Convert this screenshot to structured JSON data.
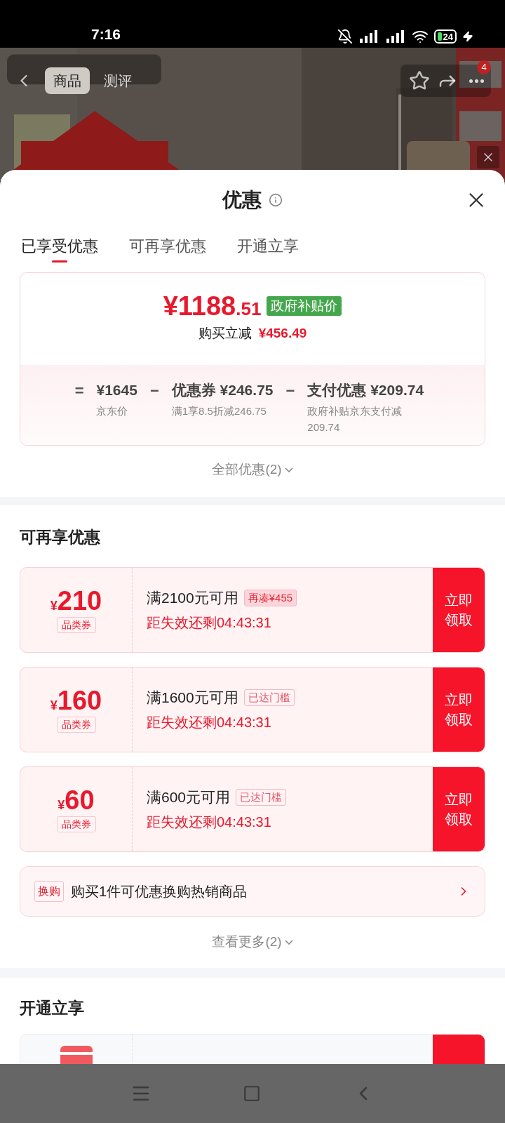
{
  "status_bar": {
    "time": "7:16",
    "battery": "24"
  },
  "product_header": {
    "tabs": [
      {
        "label": "商品",
        "selected": true
      },
      {
        "label": "测评",
        "selected": false
      }
    ],
    "badge": "4"
  },
  "sheet": {
    "title": "优惠",
    "tabs": [
      {
        "label": "已享受优惠",
        "selected": true
      },
      {
        "label": "可再享优惠",
        "selected": false
      },
      {
        "label": "开通立享",
        "selected": false
      }
    ],
    "summary": {
      "price_main": "¥1188",
      "price_decimal": ".51",
      "price_tag": "政府补贴价",
      "saving_label": "购买立减",
      "saving_value": "¥456.49",
      "breakdown": [
        {
          "operator": "=",
          "value": "¥1645",
          "note": "京东价"
        },
        {
          "operator": "−",
          "value": "优惠券 ¥246.75",
          "note": "满1享8.5折减246.75"
        },
        {
          "operator": "−",
          "value": "支付优惠 ¥209.74",
          "note": "政府补贴京东支付减209.74"
        }
      ]
    },
    "all_offers_link": "全部优惠(2)",
    "more_section": {
      "title": "可再享优惠",
      "coupons": [
        {
          "currency": "¥",
          "amount": "210",
          "type": "品类券",
          "condition": "满2100元可用",
          "tag": "再凑¥455",
          "tag_highlighted": true,
          "countdown": "距失效还剩04:43:31",
          "button": "立即领取"
        },
        {
          "currency": "¥",
          "amount": "160",
          "type": "品类券",
          "condition": "满1600元可用",
          "tag": "已达门槛",
          "tag_highlighted": false,
          "countdown": "距失效还剩04:43:31",
          "button": "立即领取"
        },
        {
          "currency": "¥",
          "amount": "60",
          "type": "品类券",
          "condition": "满600元可用",
          "tag": "已达门槛",
          "tag_highlighted": false,
          "countdown": "距失效还剩04:43:31",
          "button": "立即领取"
        }
      ],
      "exchange": {
        "tag": "换购",
        "text": "购买1件可优惠换购热销商品"
      },
      "more_link": "查看更多(2)"
    },
    "open_section": {
      "title": "开通立享"
    }
  }
}
